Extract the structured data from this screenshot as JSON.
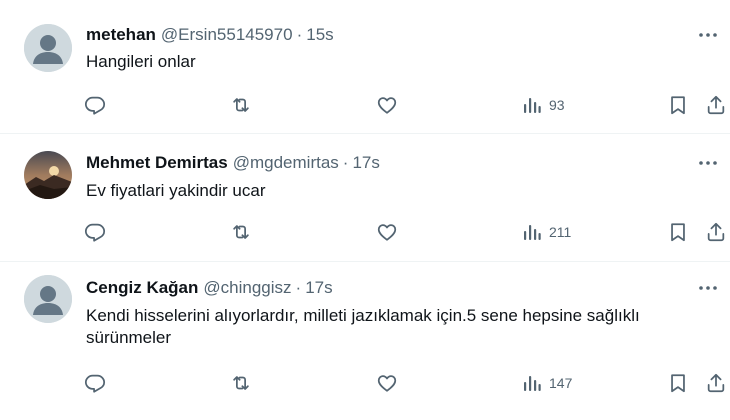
{
  "tweets": [
    {
      "name": "metehan",
      "handle": "@Ersin55145970",
      "separator": "·",
      "time": "15s",
      "text": "Hangileri onlar",
      "views": "93",
      "avatar": "default-avatar"
    },
    {
      "name": "Mehmet Demirtas",
      "handle": "@mgdemirtas",
      "separator": "·",
      "time": "17s",
      "text": "Ev fiyatlari yakindir ucar",
      "views": "211",
      "avatar": "sunset-photo-avatar"
    },
    {
      "name": "Cengiz Kağan",
      "handle": "@chinggisz",
      "separator": "·",
      "time": "17s",
      "text": "Kendi hisselerini alıyorlardır, milleti jazıklamak için.5 sene hepsine sağlıklı sürünmeler",
      "views": "147",
      "avatar": "default-avatar"
    }
  ],
  "icons": {
    "reply": "reply-icon",
    "retweet": "retweet-icon",
    "like": "heart-icon",
    "views": "views-chart-icon",
    "bookmark": "bookmark-icon",
    "share": "share-icon",
    "more": "more-dots-icon"
  },
  "colors": {
    "text": "#0f1419",
    "secondary": "#536471",
    "divider": "#eff3f4",
    "avatar_default": "#cfd9de"
  }
}
